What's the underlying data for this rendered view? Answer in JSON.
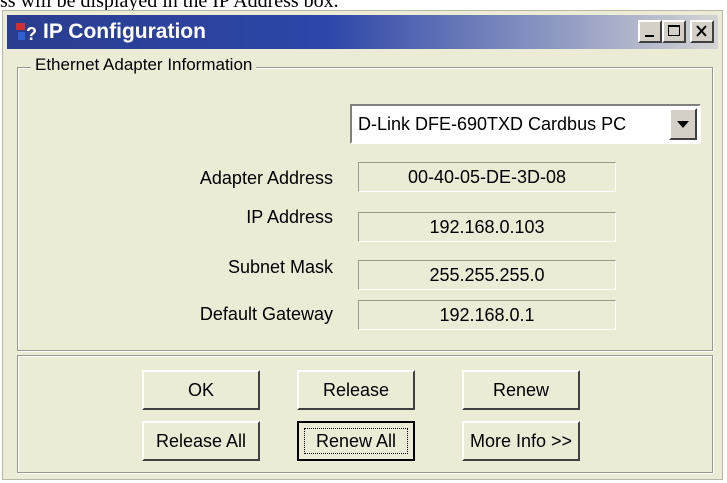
{
  "document": {
    "text_above": "ss will be displayed in the IP Address box."
  },
  "window": {
    "title": "IP Configuration",
    "controls": [
      "minimize-icon",
      "maximize-icon",
      "close-icon"
    ]
  },
  "adapter_group": {
    "legend": "Ethernet  Adapter Information",
    "adapter_select": {
      "selected": "D-Link DFE-690TXD Cardbus PC"
    },
    "rows": [
      {
        "label": "Adapter Address",
        "value": "00-40-05-DE-3D-08"
      },
      {
        "label": "IP Address",
        "value": "192.168.0.103"
      },
      {
        "label": "Subnet Mask",
        "value": "255.255.255.0"
      },
      {
        "label": "Default Gateway",
        "value": "192.168.0.1"
      }
    ]
  },
  "buttons": {
    "ok": "OK",
    "release": "Release",
    "renew": "Renew",
    "release_all": "Release All",
    "renew_all": "Renew All",
    "more_info": "More Info >>"
  },
  "colors": {
    "titlebar": "#2d46a8",
    "dialog_bg": "#ecebd6"
  }
}
